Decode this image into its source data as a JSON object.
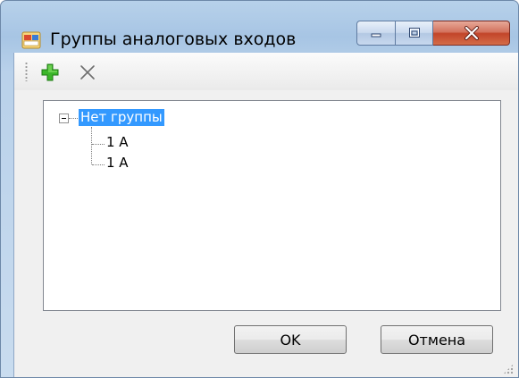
{
  "window": {
    "title": "Группы аналоговых входов"
  },
  "toolbar": {
    "add_icon": "add-plus-icon",
    "delete_icon": "delete-x-icon"
  },
  "tree": {
    "root": {
      "label": "Нет группы",
      "expanded": true,
      "selected": true,
      "children": [
        {
          "label": "1 A"
        },
        {
          "label": "1 A"
        }
      ]
    }
  },
  "buttons": {
    "ok_label": "OK",
    "cancel_label": "Отмена"
  },
  "colors": {
    "selection": "#3399ff",
    "title_bar": "#a7c5e4",
    "close_button": "#c2452a",
    "add_icon": "#2e9d1e"
  }
}
